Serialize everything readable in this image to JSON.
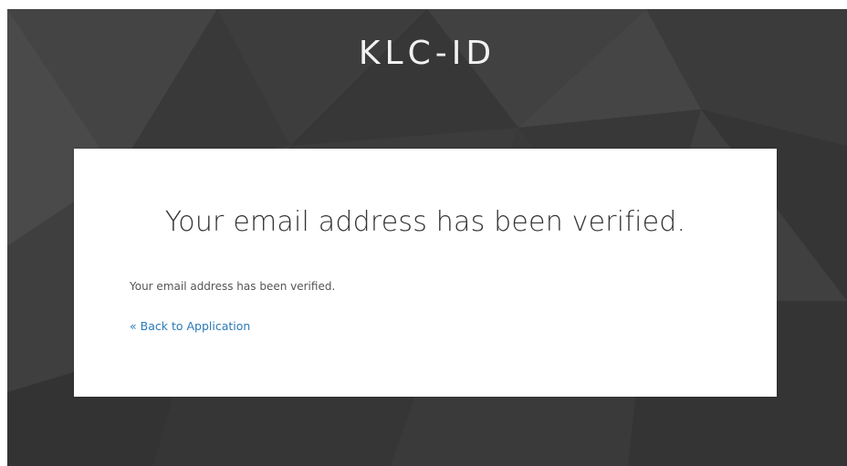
{
  "header": {
    "brand": "KLC-ID"
  },
  "card": {
    "title": "Your email address has been verified.",
    "message": "Your email address has been verified.",
    "back_link": "« Back to Application"
  },
  "colors": {
    "background": "#3a3a3a",
    "card": "#ffffff",
    "link": "#2a7ab8",
    "title_text": "#333333",
    "brand_text": "#f2f2f2"
  }
}
